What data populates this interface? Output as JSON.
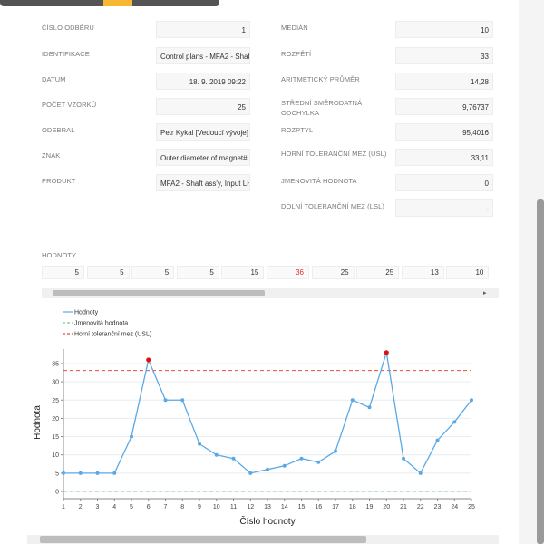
{
  "left_fields": [
    {
      "label": "ČÍSLO ODBĚRU",
      "value": "1",
      "align": "right"
    },
    {
      "label": "IDENTIFIKACE",
      "value": "Control plans - MFA2 - Shaf",
      "align": "left"
    },
    {
      "label": "DATUM",
      "value": "18. 9. 2019 09:22",
      "align": "right"
    },
    {
      "label": "POČET VZORKŮ",
      "value": "25",
      "align": "right"
    },
    {
      "label": "ODEBRAL",
      "value": "Petr Kykal [Vedoucí vývoje]",
      "align": "left"
    },
    {
      "label": "ZNAK",
      "value": "Outer diameter of magnet#",
      "align": "left"
    },
    {
      "label": "PRODUKT",
      "value": "MFA2 - Shaft ass'y, Input LH",
      "align": "left"
    }
  ],
  "right_fields": [
    {
      "label": "MEDIÁN",
      "value": "10"
    },
    {
      "label": "ROZPĚTÍ",
      "value": "33"
    },
    {
      "label": "ARITMETICKÝ PRŮMĚR",
      "value": "14,28"
    },
    {
      "label": "STŘEDNÍ SMĚRODATNÁ ODCHYLKA",
      "value": "9,76737"
    },
    {
      "label": "ROZPTYL",
      "value": "95,4016"
    },
    {
      "label": "HORNÍ TOLERANČNÍ MEZ (USL)",
      "value": "33,11"
    },
    {
      "label": "JMENOVITÁ HODNOTA",
      "value": "0"
    },
    {
      "label": "DOLNÍ TOLERANČNÍ MEZ (LSL)",
      "value": "-"
    }
  ],
  "values_section": {
    "label": "HODNOTY",
    "cells": [
      "5",
      "5",
      "5",
      "5",
      "15",
      "36",
      "25",
      "25",
      "13",
      "10"
    ],
    "highlight_color": "#e03030",
    "highlight_index": 5
  },
  "colors": {
    "accent": "#f7b733",
    "series": "#5aa9e6",
    "usl": "#e74c3c",
    "nominal": "#7dc49a",
    "out_of_spec": "#e01010"
  },
  "chart_data": {
    "type": "line",
    "x": [
      1,
      2,
      3,
      4,
      5,
      6,
      7,
      8,
      9,
      10,
      11,
      12,
      13,
      14,
      15,
      16,
      17,
      18,
      19,
      20,
      21,
      22,
      23,
      24,
      25
    ],
    "series": [
      {
        "name": "Hodnoty",
        "values": [
          5,
          5,
          5,
          5,
          15,
          36,
          25,
          25,
          13,
          10,
          9,
          5,
          6,
          7,
          9,
          8,
          11,
          25,
          23,
          38,
          9,
          5,
          14,
          19,
          25
        ]
      },
      {
        "name": "Jmenovitá hodnota",
        "values": [
          0,
          0,
          0,
          0,
          0,
          0,
          0,
          0,
          0,
          0,
          0,
          0,
          0,
          0,
          0,
          0,
          0,
          0,
          0,
          0,
          0,
          0,
          0,
          0,
          0
        ]
      },
      {
        "name": "Horní toleranční mez (USL)",
        "values": [
          33.11,
          33.11,
          33.11,
          33.11,
          33.11,
          33.11,
          33.11,
          33.11,
          33.11,
          33.11,
          33.11,
          33.11,
          33.11,
          33.11,
          33.11,
          33.11,
          33.11,
          33.11,
          33.11,
          33.11,
          33.11,
          33.11,
          33.11,
          33.11,
          33.11
        ]
      }
    ],
    "highlighted_points": [
      6,
      20
    ],
    "xlabel": "Číslo hodnoty",
    "ylabel": "Hodnota",
    "xlim": [
      1,
      25
    ],
    "ylim": [
      -2,
      39
    ],
    "yticks": [
      0,
      5,
      10,
      15,
      20,
      25,
      30,
      35
    ],
    "grid": true,
    "legend_position": "top-left"
  }
}
